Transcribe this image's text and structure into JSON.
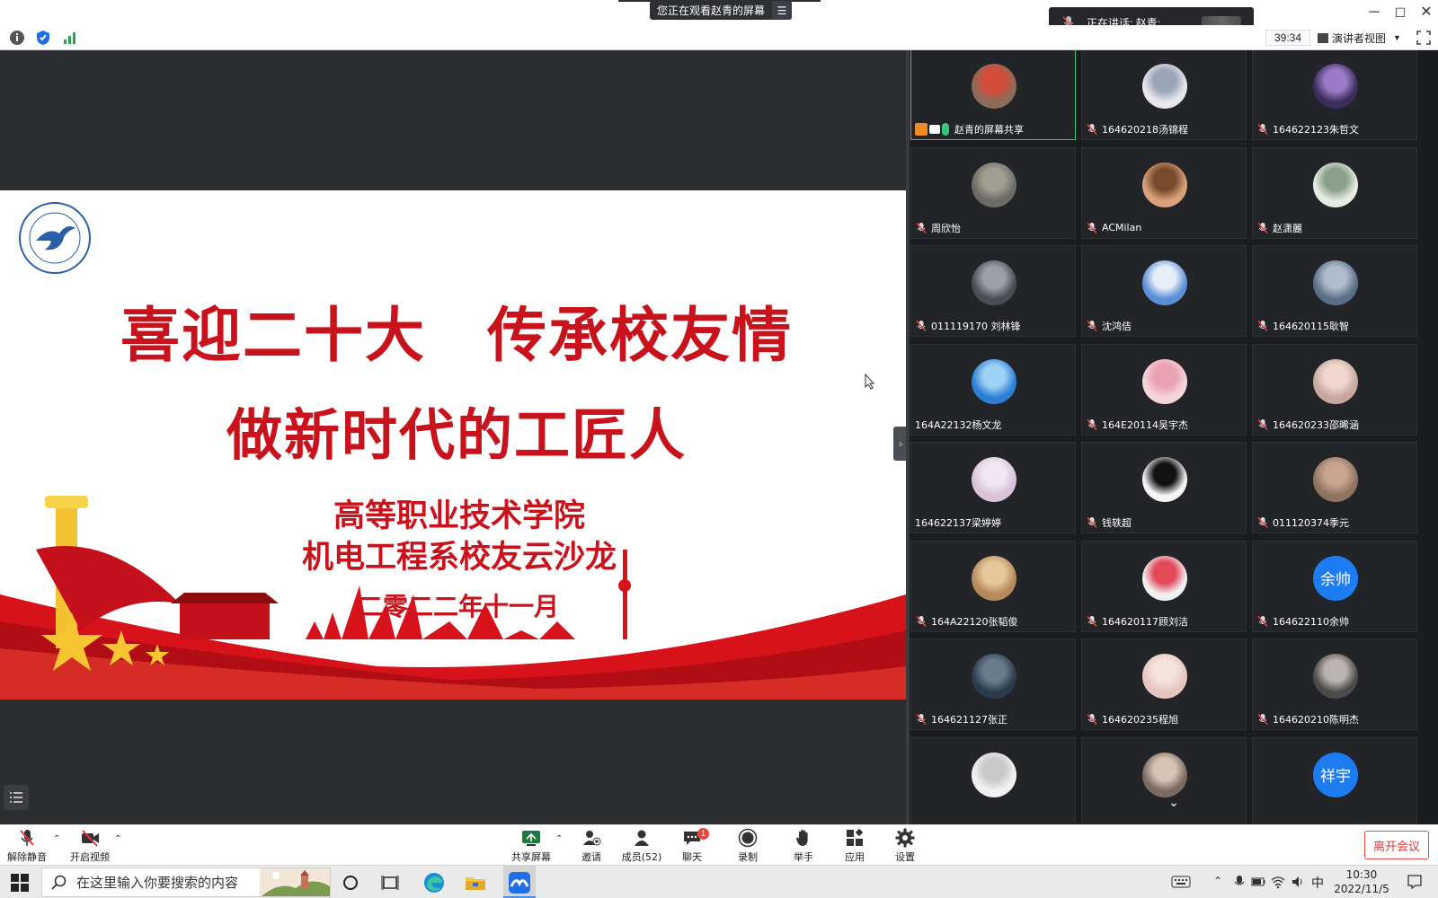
{
  "banner": {
    "viewing_text": "您正在观看赵青的屏幕",
    "menu_icon": "menu-lines-icon"
  },
  "speaking": {
    "label": "正在讲话: 赵青;"
  },
  "toolbar": {
    "timer": "39:34",
    "view_label": "演讲者视图"
  },
  "slide": {
    "title_line1": "喜迎二十大　传承校友情",
    "title_line2": "做新时代的工匠人",
    "org_line1": "高等职业技术学院",
    "org_line2": "机电工程系校友云沙龙",
    "date": "二零二二年十一月"
  },
  "colors": {
    "slide_red": "#c8131c",
    "active_border": "#3ac47d",
    "avatar_blue": "#1e7cf2"
  },
  "participants": [
    {
      "name": "赵青的屏幕共享",
      "avatar": "photo",
      "active": true
    },
    {
      "name": "164620218汤锦程",
      "avatar": "photo"
    },
    {
      "name": "164622123朱哲文",
      "avatar": "photo"
    },
    {
      "name": "周欣怡",
      "avatar": "photo"
    },
    {
      "name": "ACMilan",
      "avatar": "photo"
    },
    {
      "name": "赵潇麗",
      "avatar": "photo"
    },
    {
      "name": "011119170 刘林锋",
      "avatar": "photo"
    },
    {
      "name": "沈鸿佶",
      "avatar": "photo"
    },
    {
      "name": "164620115耿智",
      "avatar": "photo"
    },
    {
      "name": "164A22132杨文龙",
      "avatar": "photo",
      "unmuted": true
    },
    {
      "name": "164E20114吴宇杰",
      "avatar": "photo"
    },
    {
      "name": "164620233邵晞涵",
      "avatar": "photo"
    },
    {
      "name": "164622137梁婷婷",
      "avatar": "photo",
      "unmuted": true
    },
    {
      "name": "钱轶超",
      "avatar": "photo"
    },
    {
      "name": "011120374季元",
      "avatar": "photo"
    },
    {
      "name": "164A22120张韬俊",
      "avatar": "photo"
    },
    {
      "name": "164620117顾刘洁",
      "avatar": "photo"
    },
    {
      "name": "164622110余帅",
      "avatar_text": "余帅"
    },
    {
      "name": "164621127张正",
      "avatar": "photo"
    },
    {
      "name": "164620235程旭",
      "avatar": "photo"
    },
    {
      "name": "164620210陈明杰",
      "avatar": "photo"
    },
    {
      "name": "",
      "avatar": "photo"
    },
    {
      "name": "",
      "avatar": "photo"
    },
    {
      "name": "",
      "avatar_text": "祥宇"
    }
  ],
  "meeting_bar": {
    "unmute": "解除静音",
    "start_video": "开启视频",
    "share_screen": "共享屏幕",
    "invite": "邀请",
    "members": "成员(52)",
    "chat": "聊天",
    "chat_badge": "1",
    "record": "录制",
    "raise_hand": "举手",
    "apps": "应用",
    "settings": "设置",
    "leave": "离开会议"
  },
  "taskbar": {
    "search_placeholder": "在这里输入你要搜索的内容",
    "ime": "中",
    "time": "10:30",
    "date": "2022/11/5"
  }
}
